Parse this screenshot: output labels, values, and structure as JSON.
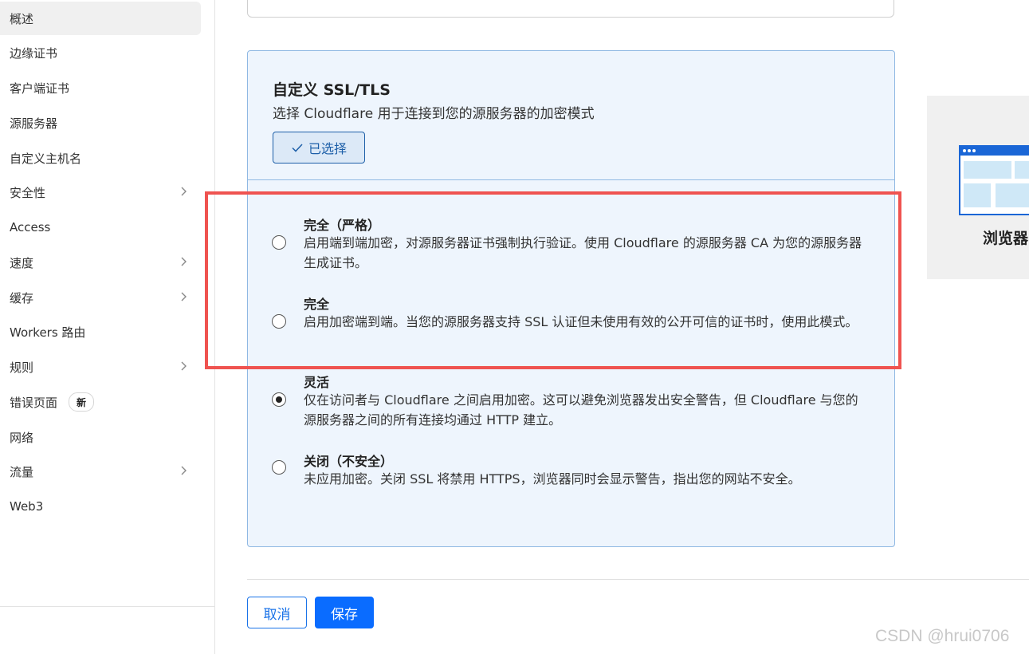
{
  "sidebar": {
    "items": [
      {
        "label": "概述",
        "active": true,
        "chevron": false
      },
      {
        "label": "边缘证书",
        "active": false,
        "chevron": false
      },
      {
        "label": "客户端证书",
        "active": false,
        "chevron": false
      },
      {
        "label": "源服务器",
        "active": false,
        "chevron": false
      },
      {
        "label": "自定义主机名",
        "active": false,
        "chevron": false
      },
      {
        "label": "安全性",
        "active": false,
        "chevron": true
      },
      {
        "label": "Access",
        "active": false,
        "chevron": false
      },
      {
        "label": "速度",
        "active": false,
        "chevron": true
      },
      {
        "label": "缓存",
        "active": false,
        "chevron": true
      },
      {
        "label": "Workers 路由",
        "active": false,
        "chevron": false
      },
      {
        "label": "规则",
        "active": false,
        "chevron": true
      },
      {
        "label": "错误页面",
        "active": false,
        "chevron": false,
        "badge": "新"
      },
      {
        "label": "网络",
        "active": false,
        "chevron": false
      },
      {
        "label": "流量",
        "active": false,
        "chevron": true
      },
      {
        "label": "Web3",
        "active": false,
        "chevron": false
      }
    ]
  },
  "card": {
    "title": "自定义 SSL/TLS",
    "subtitle": "选择 Cloudflare 用于连接到您的源服务器的加密模式",
    "selected_label": "已选择",
    "options": [
      {
        "title": "完全（严格）",
        "description": "启用端到端加密，对源服务器证书强制执行验证。使用 Cloudflare 的源服务器 CA 为您的源服务器生成证书。",
        "checked": false
      },
      {
        "title": "完全",
        "description": "启用加密端到端。当您的源服务器支持 SSL 认证但未使用有效的公开可信的证书时，使用此模式。",
        "checked": false
      },
      {
        "title": "灵活",
        "description": "仅在访问者与 Cloudflare 之间启用加密。这可以避免浏览器发出安全警告，但 Cloudflare 与您的源服务器之间的所有连接均通过 HTTP 建立。",
        "checked": true
      },
      {
        "title": "关闭（不安全）",
        "description": "未应用加密。关闭 SSL 将禁用 HTTPS，浏览器同时会显示警告，指出您的网站不安全。",
        "checked": false
      }
    ]
  },
  "actions": {
    "cancel_label": "取消",
    "save_label": "保存"
  },
  "promo": {
    "label": "浏览器"
  },
  "watermark": "CSDN @hrui0706",
  "colors": {
    "accent": "#0a6cff",
    "card_bg": "#eef5fd",
    "card_border": "#8fb8e3",
    "highlight": "#ef5350"
  }
}
